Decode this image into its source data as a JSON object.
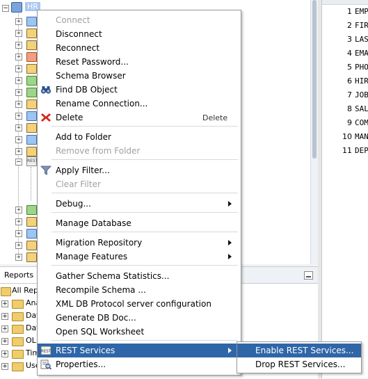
{
  "connection": {
    "name": "HR"
  },
  "reports": {
    "tab_label": "Reports",
    "items": [
      {
        "label": "All Repo"
      },
      {
        "label": "Ana"
      },
      {
        "label": "Dat"
      },
      {
        "label": "Dat"
      },
      {
        "label": "OL"
      },
      {
        "label": "Tim"
      },
      {
        "label": "Use"
      }
    ]
  },
  "grid": {
    "rows": [
      {
        "num": "1",
        "value": "EMP"
      },
      {
        "num": "2",
        "value": "FIR"
      },
      {
        "num": "3",
        "value": "LAS"
      },
      {
        "num": "4",
        "value": "EMA"
      },
      {
        "num": "5",
        "value": "PHO"
      },
      {
        "num": "6",
        "value": "HIR"
      },
      {
        "num": "7",
        "value": "JOB"
      },
      {
        "num": "8",
        "value": "SAL"
      },
      {
        "num": "9",
        "value": "COM"
      },
      {
        "num": "10",
        "value": "MAN"
      },
      {
        "num": "11",
        "value": "DEP"
      }
    ]
  },
  "menu": {
    "connect": "Connect",
    "disconnect": "Disconnect",
    "reconnect": "Reconnect",
    "reset_password": "Reset Password...",
    "schema_browser": "Schema Browser",
    "find_db_object": "Find DB Object",
    "rename_connection": "Rename Connection...",
    "delete": "Delete",
    "delete_shortcut": "Delete",
    "add_to_folder": "Add to Folder",
    "remove_from_folder": "Remove from Folder",
    "apply_filter": "Apply Filter...",
    "clear_filter": "Clear Filter",
    "debug": "Debug...",
    "manage_database": "Manage Database",
    "migration_repository": "Migration Repository",
    "manage_features": "Manage Features",
    "gather_schema_statistics": "Gather Schema Statistics...",
    "recompile_schema": "Recompile Schema ...",
    "xml_db_protocol": "XML DB Protocol server configuration",
    "generate_db_doc": "Generate DB Doc...",
    "open_sql_worksheet": "Open SQL Worksheet",
    "rest_services": "REST Services",
    "properties": "Properties..."
  },
  "submenu": {
    "enable_rest": "Enable REST Services...",
    "drop_rest": "Drop REST Services..."
  },
  "icons": {
    "find": "binoculars-icon",
    "delete": "red-x-icon",
    "filter": "funnel-icon",
    "rest": "rest-icon",
    "properties": "properties-icon"
  },
  "colors": {
    "highlight": "#2f66a8",
    "disabled_text": "#a0a0a0"
  }
}
